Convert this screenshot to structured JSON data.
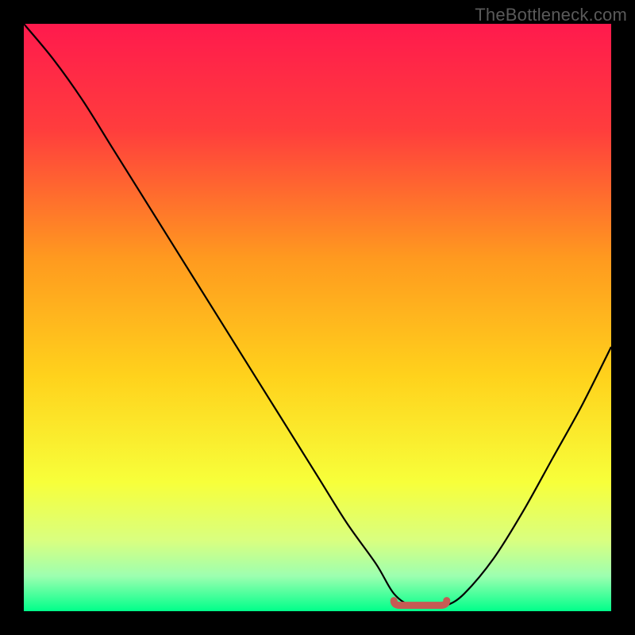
{
  "watermark": "TheBottleneck.com",
  "colors": {
    "frame": "#000000",
    "gradient_stops": [
      {
        "pos": 0.0,
        "color": "#ff1a4d"
      },
      {
        "pos": 0.18,
        "color": "#ff3d3d"
      },
      {
        "pos": 0.4,
        "color": "#ff9a1f"
      },
      {
        "pos": 0.6,
        "color": "#ffd21c"
      },
      {
        "pos": 0.78,
        "color": "#f7ff3a"
      },
      {
        "pos": 0.88,
        "color": "#d9ff80"
      },
      {
        "pos": 0.94,
        "color": "#9dffb0"
      },
      {
        "pos": 1.0,
        "color": "#00ff8a"
      }
    ],
    "curve": "#000000",
    "marker": "#c65b54"
  },
  "chart_data": {
    "type": "line",
    "title": "",
    "xlabel": "",
    "ylabel": "",
    "xlim": [
      0,
      100
    ],
    "ylim": [
      0,
      100
    ],
    "grid": false,
    "legend": false,
    "series": [
      {
        "name": "bottleneck-curve",
        "x": [
          0,
          5,
          10,
          15,
          20,
          25,
          30,
          35,
          40,
          45,
          50,
          55,
          60,
          63,
          66,
          70,
          72,
          75,
          80,
          85,
          90,
          95,
          100
        ],
        "y": [
          100,
          94,
          87,
          79,
          71,
          63,
          55,
          47,
          39,
          31,
          23,
          15,
          8,
          3,
          1,
          1,
          1,
          3,
          9,
          17,
          26,
          35,
          45
        ]
      }
    ],
    "markers": [
      {
        "name": "optimal-range",
        "x": [
          63,
          66,
          70,
          72
        ],
        "y": [
          1,
          1,
          1,
          1
        ]
      }
    ]
  }
}
